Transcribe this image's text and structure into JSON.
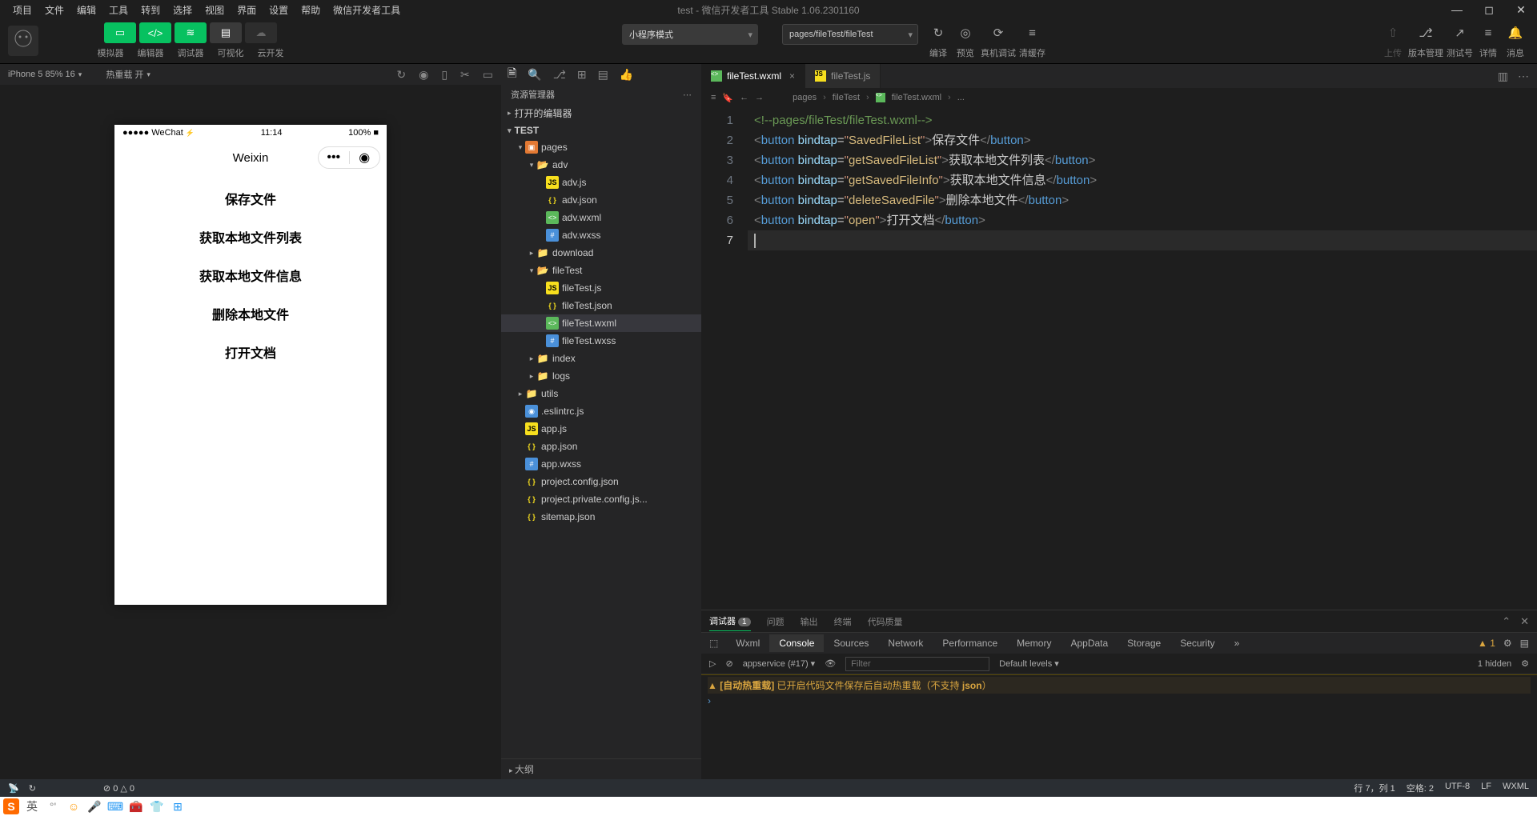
{
  "menu": [
    "项目",
    "文件",
    "编辑",
    "工具",
    "转到",
    "选择",
    "视图",
    "界面",
    "设置",
    "帮助",
    "微信开发者工具"
  ],
  "window_title": "test - 微信开发者工具 Stable 1.06.2301160",
  "toolbar": {
    "group1_labels": [
      "模拟器",
      "编辑器",
      "调试器",
      "可视化",
      "云开发"
    ],
    "mode_dropdown": "小程序模式",
    "path_dropdown": "pages/fileTest/fileTest",
    "actions": [
      {
        "icon": "↻",
        "label": "编译"
      },
      {
        "icon": "◎",
        "label": "预览"
      },
      {
        "icon": "⟳",
        "label": "真机调试"
      },
      {
        "icon": "≡",
        "label": "清缓存"
      }
    ],
    "right": [
      {
        "icon": "⇧",
        "label": "上传",
        "disabled": true
      },
      {
        "icon": "⎇",
        "label": "版本管理"
      },
      {
        "icon": "↗",
        "label": "测试号"
      },
      {
        "icon": "≡",
        "label": "详情"
      },
      {
        "icon": "🔔",
        "label": "消息"
      }
    ]
  },
  "sim": {
    "device": "iPhone 5 85% 16",
    "reload": "热重载 开",
    "phone": {
      "wechat": "●●●●● WeChat",
      "time": "11:14",
      "battery": "100%",
      "title": "Weixin",
      "buttons": [
        "保存文件",
        "获取本地文件列表",
        "获取本地文件信息",
        "删除本地文件",
        "打开文档"
      ]
    }
  },
  "explorer": {
    "title": "资源管理器",
    "sections": [
      "打开的编辑器",
      "TEST"
    ],
    "outline": "大纲"
  },
  "tree": {
    "root": "pages",
    "adv": {
      "name": "adv",
      "files": [
        "adv.js",
        "adv.json",
        "adv.wxml",
        "adv.wxss"
      ]
    },
    "download": "download",
    "fileTest": {
      "name": "fileTest",
      "files": [
        "fileTest.js",
        "fileTest.json",
        "fileTest.wxml",
        "fileTest.wxss"
      ]
    },
    "index": "index",
    "logs": "logs",
    "utils": "utils",
    "rootfiles": [
      ".eslintrc.js",
      "app.js",
      "app.json",
      "app.wxss",
      "project.config.json",
      "project.private.config.js...",
      "sitemap.json"
    ]
  },
  "tabs": [
    {
      "name": "fileTest.wxml",
      "active": true
    },
    {
      "name": "fileTest.js",
      "active": false
    }
  ],
  "breadcrumb": [
    "pages",
    "fileTest",
    "fileTest.wxml",
    "..."
  ],
  "code": {
    "lines": [
      {
        "n": 1,
        "type": "comment",
        "text": "<!--pages/fileTest/fileTest.wxml-->"
      },
      {
        "n": 2,
        "fn": "SavedFileList",
        "txt": "保存文件"
      },
      {
        "n": 3,
        "fn": "getSavedFileList",
        "txt": "获取本地文件列表"
      },
      {
        "n": 4,
        "fn": "getSavedFileInfo",
        "txt": "获取本地文件信息"
      },
      {
        "n": 5,
        "fn": "deleteSavedFile",
        "txt": "删除本地文件"
      },
      {
        "n": 6,
        "fn": "open",
        "txt": "打开文档"
      },
      {
        "n": 7,
        "type": "empty"
      }
    ]
  },
  "panel": {
    "tabs": [
      "调试器",
      "问题",
      "输出",
      "终端",
      "代码质量"
    ],
    "badge": "1",
    "devtabs": [
      "Wxml",
      "Console",
      "Sources",
      "Network",
      "Performance",
      "Memory",
      "AppData",
      "Storage",
      "Security"
    ],
    "warn_count": "1",
    "filter": {
      "context": "appservice (#17)",
      "placeholder": "Filter",
      "levels": "Default levels",
      "hidden": "1 hidden"
    },
    "console_warn_prefix": "[自动热重载]",
    "console_warn_text": " 已开启代码文件保存后自动热重载（不支持 ",
    "console_warn_code": "json",
    "console_warn_suffix": "）"
  },
  "status": {
    "errors": "⊘ 0 △ 0",
    "pos": "行 7，列 1",
    "spaces": "空格: 2",
    "enc": "UTF-8",
    "eol": "LF",
    "lang": "WXML"
  },
  "taskbar_ime": "英"
}
